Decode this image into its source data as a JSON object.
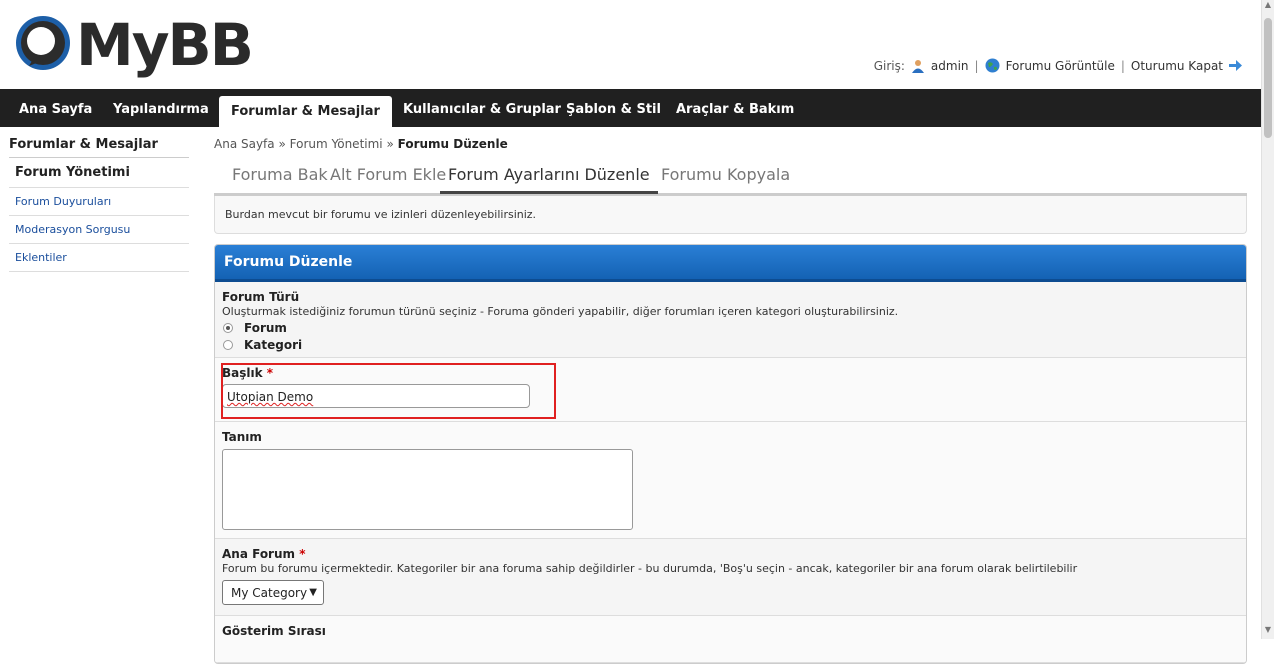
{
  "app": {
    "logo_text": "MyBB"
  },
  "userbar": {
    "login_label": "Giriş:",
    "user": "admin",
    "view_forum": "Forumu Görüntüle",
    "logout": "Oturumu Kapat",
    "icons": [
      "user-icon",
      "globe-icon",
      "arrow-right-icon"
    ]
  },
  "nav": {
    "items": [
      {
        "label": "Ana Sayfa"
      },
      {
        "label": "Yapılandırma"
      },
      {
        "label": "Forumlar & Mesajlar",
        "active": true
      },
      {
        "label": "Kullanıcılar & Gruplar"
      },
      {
        "label": "Şablon & Stil"
      },
      {
        "label": "Araçlar & Bakım"
      }
    ]
  },
  "sidebar": {
    "title": "Forumlar & Mesajlar",
    "items": [
      {
        "label": "Forum Yönetimi"
      },
      {
        "label": "Forum Duyuruları"
      },
      {
        "label": "Moderasyon Sorgusu"
      },
      {
        "label": "Eklentiler"
      }
    ]
  },
  "breadcrumb": {
    "home": "Ana Sayfa",
    "sep": "»",
    "level1": "Forum Yönetimi",
    "current": "Forumu Düzenle"
  },
  "tabs": [
    {
      "label": "Foruma Bak"
    },
    {
      "label": "Alt Forum Ekle"
    },
    {
      "label": "Forum Ayarlarını Düzenle",
      "active": true
    },
    {
      "label": "Forumu Kopyala"
    }
  ],
  "description": "Burdan mevcut bir forumu ve izinleri düzenleyebilirsiniz.",
  "panel": {
    "title": "Forumu Düzenle",
    "forum_type": {
      "label": "Forum Türü",
      "hint": "Oluşturmak istediğiniz forumun türünü seçiniz - Foruma gönderi yapabilir, diğer forumları içeren kategori oluşturabilirsiniz.",
      "options": [
        {
          "label": "Forum",
          "checked": true
        },
        {
          "label": "Kategori",
          "checked": false
        }
      ]
    },
    "title_field": {
      "label": "Başlık",
      "required": "*",
      "value": "Utopian Demo"
    },
    "description_field": {
      "label": "Tanım",
      "value": ""
    },
    "parent_forum": {
      "label": "Ana Forum",
      "required": "*",
      "hint": "Forum bu forumu içermektedir. Kategoriler bir ana foruma sahip değildirler - bu durumda, 'Boş'u seçin - ancak, kategoriler bir ana forum olarak belirtilebilir",
      "value": "My Category",
      "arrow": "▼"
    },
    "display_order": {
      "label": "Gösterim Sırası"
    }
  },
  "colors": {
    "nav_bg": "#202020",
    "panel_head": "#1a6cc4",
    "highlight_border": "#e02020"
  }
}
